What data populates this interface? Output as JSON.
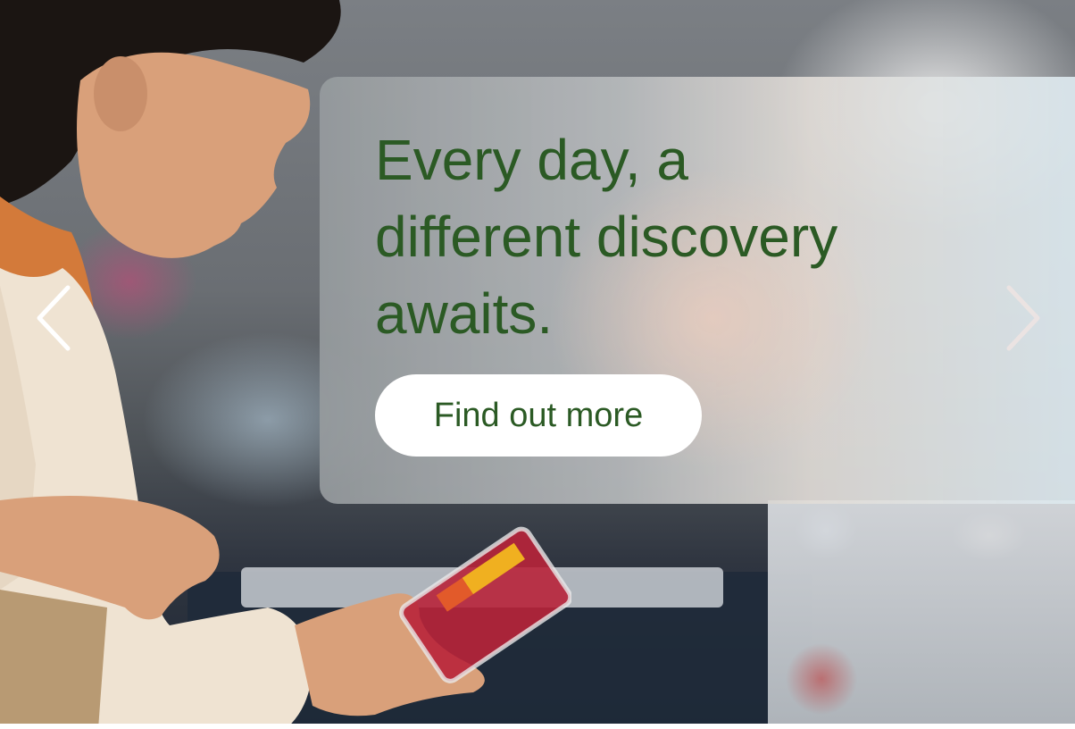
{
  "hero": {
    "headline_lines": [
      "Every day, a",
      "different discovery",
      "awaits."
    ],
    "cta_label": "Find out more",
    "background_image": "woman-holding-berry-container-in-store",
    "prev_icon": "chevron-left-icon",
    "next_icon": "chevron-right-icon"
  },
  "colors": {
    "headline": "#2b5a24",
    "button_bg": "#ffffff",
    "button_text": "#2b5a24"
  }
}
